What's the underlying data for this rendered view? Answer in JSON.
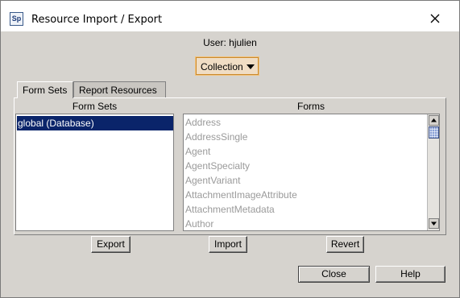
{
  "window": {
    "title": "Resource Import / Export",
    "app_icon_text": "Sp"
  },
  "user_line": "User: hjulien",
  "combo": {
    "selected": "Collection"
  },
  "tabs": [
    {
      "label": "Form Sets",
      "active": true
    },
    {
      "label": "Report Resources",
      "active": false
    }
  ],
  "form_sets": {
    "header": "Form Sets",
    "items": [
      {
        "label": "global (Database)",
        "selected": true
      }
    ]
  },
  "forms": {
    "header": "Forms",
    "items": [
      "Address",
      "AddressSingle",
      "Agent",
      "AgentSpecialty",
      "AgentVariant",
      "AttachmentImageAttribute",
      "AttachmentMetadata",
      "Author"
    ]
  },
  "actions": {
    "export": "Export",
    "import": "Import",
    "revert": "Revert"
  },
  "footer": {
    "close": "Close",
    "help": "Help"
  },
  "colors": {
    "selection": "#0a246a",
    "dialog_bg": "#d6d3ce",
    "combo_bg": "#f0ddc4"
  }
}
